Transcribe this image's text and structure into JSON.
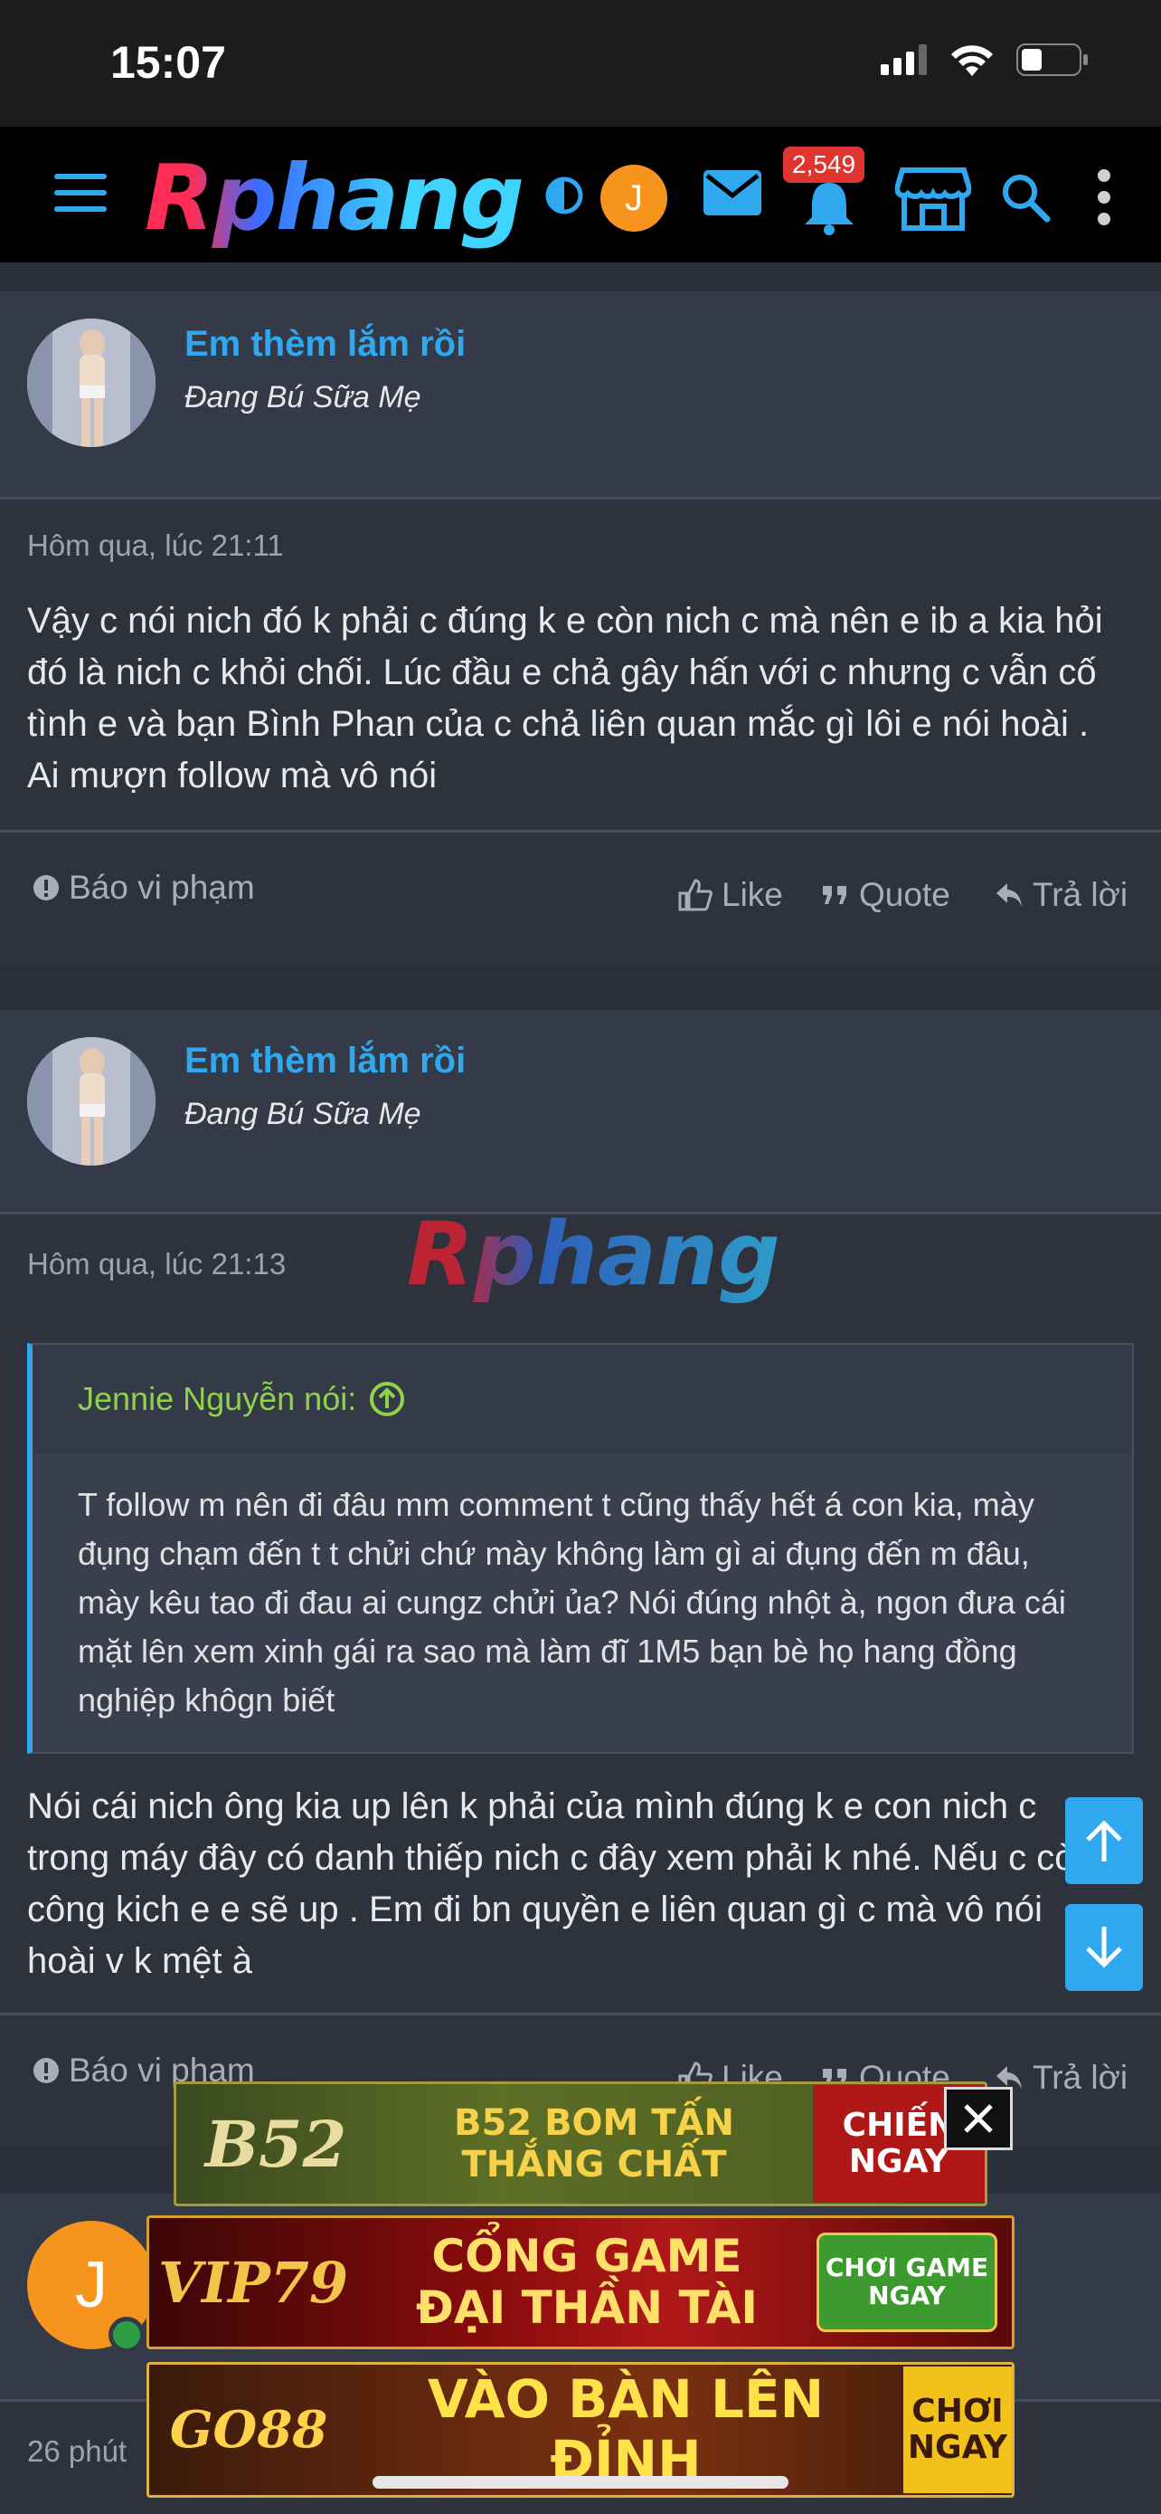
{
  "status_bar": {
    "time": "15:07"
  },
  "nav": {
    "logo": "Rphang",
    "user_initial": "J",
    "notifications_badge": "2,549"
  },
  "posts": [
    {
      "username": "Em thèm lắm rồi",
      "user_title": "Đang Bú Sữa Mẹ",
      "date": "Hôm qua, lúc 21:11",
      "body": "Vậy c nói nich đó k phải c đúng k e còn nich c mà nên e ib a kia hỏi đó là nich c khỏi chối. Lúc đầu e chả gây hấn với c nhưng c vẫn cố tình e và bạn Bình Phan của c chả liên quan mắc gì lôi e nói hoài . Ai mượn follow mà vô nói",
      "report": "Báo vi phạm",
      "like": "Like",
      "quote": "Quote",
      "reply": "Trả lời"
    },
    {
      "username": "Em thèm lắm rồi",
      "user_title": "Đang Bú Sữa Mẹ",
      "date": "Hôm qua, lúc 21:13",
      "quote_author": "Jennie Nguyễn nói:",
      "quote_text": "T follow m nên đi đâu mm comment t cũng thấy hết á con kia, mày đụng chạm đến t t chửi chứ mày không làm gì ai đụng đến m đâu, mày kêu tao đi đau ai cungz chửi ủa? Nói đúng nhột à, ngon đưa cái mặt lên xem xinh gái ra sao mà làm đĩ 1M5 bạn bè họ hang đồng nghiệp khôgn biết",
      "body": "Nói cái nich ông kia up lên k phải của mình đúng k e con nich c trong máy đây có danh thiếp nich c đây xem phải k nhé. Nếu c còn công kich e e sẽ up . Em đi bn quyền e liên quan gì c mà vô nói hoài v k mệt à",
      "report": "Báo vi phạm",
      "like": "Like",
      "quote": "Quote",
      "reply": "Trả lời"
    },
    {
      "avatar_initial": "J",
      "date": "26 phút"
    }
  ],
  "watermark": "Rphang",
  "ads": [
    {
      "logo": "B52",
      "main": "B52 BOM TẤN\nTHẮNG CHẤT",
      "cta": "CHIẾN\nNGAY"
    },
    {
      "logo": "VIP79",
      "main": "CỔNG GAME\nĐẠI THẦN TÀI",
      "cta": "CHƠI GAME\nNGAY"
    },
    {
      "logo": "GO88",
      "main": "VÀO BÀN LÊN ĐỈNH",
      "cta": "CHƠI\nNGAY"
    }
  ],
  "colors": {
    "accent": "#2fa8f0",
    "background": "#2b2f3a",
    "quote_author": "#8ed34b"
  }
}
